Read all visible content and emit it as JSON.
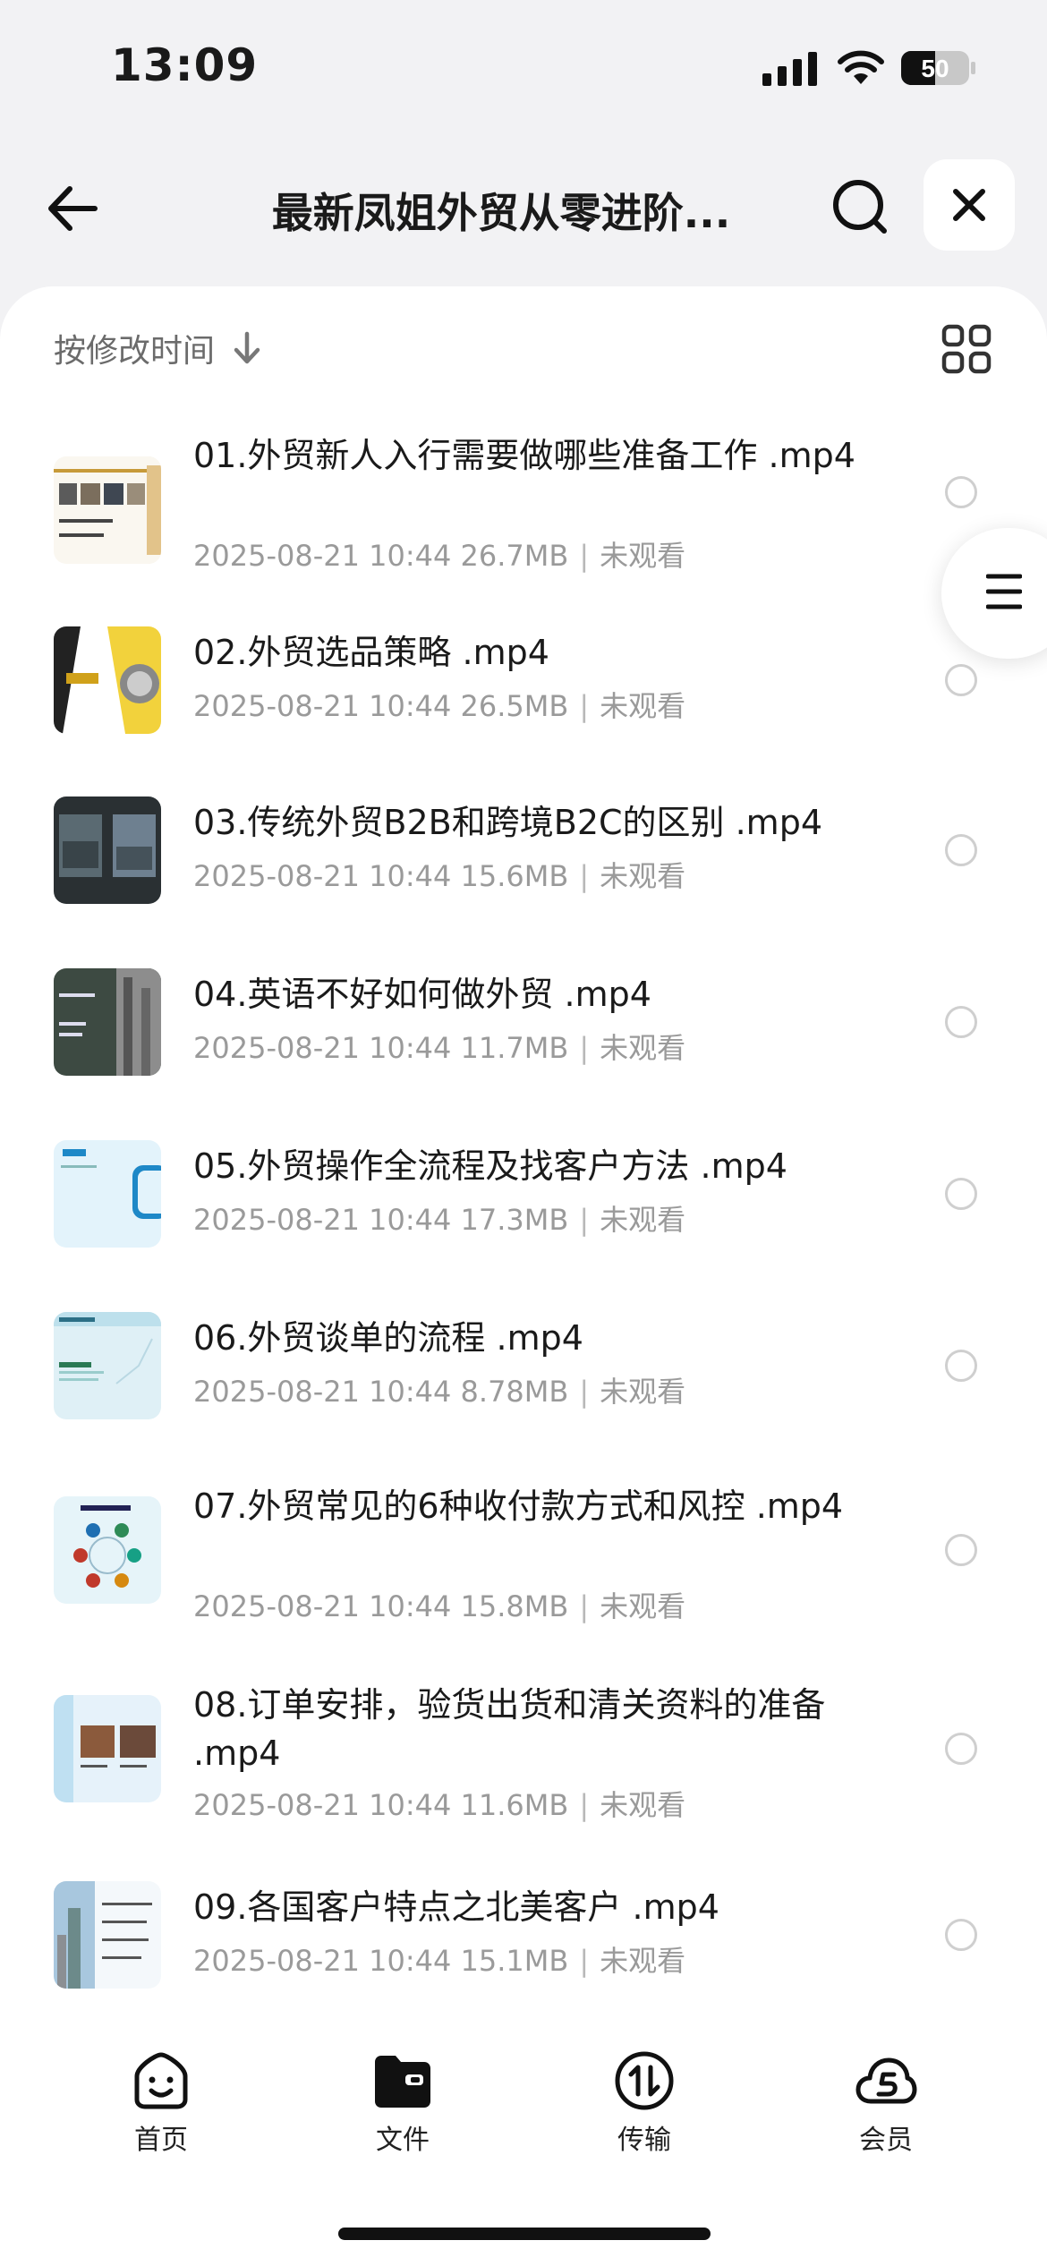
{
  "status_bar": {
    "time": "13:09",
    "battery_level": "50",
    "icons": [
      "signal-icon",
      "wifi-icon",
      "battery-icon"
    ]
  },
  "header": {
    "title": "最新凤姐外贸从零进阶...",
    "back_icon": "back-arrow-icon",
    "search_icon": "search-icon",
    "close_icon": "close-icon"
  },
  "toolbar": {
    "sort_label": "按修改时间",
    "sort_icon": "arrow-down-icon",
    "view_icon": "grid-icon"
  },
  "files": [
    {
      "name": "01.外贸新人入行需要做哪些准备工作 .mp4",
      "date": "2025-08-21 10:44",
      "size": "26.7MB",
      "status": "未观看"
    },
    {
      "name": "02.外贸选品策略 .mp4",
      "date": "2025-08-21 10:44",
      "size": "26.5MB",
      "status": "未观看"
    },
    {
      "name": "03.传统外贸B2B和跨境B2C的区别 .mp4",
      "date": "2025-08-21 10:44",
      "size": "15.6MB",
      "status": "未观看"
    },
    {
      "name": "04.英语不好如何做外贸 .mp4",
      "date": "2025-08-21 10:44",
      "size": "11.7MB",
      "status": "未观看"
    },
    {
      "name": "05.外贸操作全流程及找客户方法 .mp4",
      "date": "2025-08-21 10:44",
      "size": "17.3MB",
      "status": "未观看"
    },
    {
      "name": "06.外贸谈单的流程 .mp4",
      "date": "2025-08-21 10:44",
      "size": "8.78MB",
      "status": "未观看"
    },
    {
      "name": "07.外贸常见的6种收付款方式和风控 .mp4",
      "date": "2025-08-21 10:44",
      "size": "15.8MB",
      "status": "未观看"
    },
    {
      "name": "08.订单安排，验货出货和清关资料的准备 .mp4",
      "date": "2025-08-21 10:44",
      "size": "11.6MB",
      "status": "未观看"
    },
    {
      "name": "09.各国客户特点之北美客户 .mp4",
      "date": "2025-08-21 10:44",
      "size": "15.1MB",
      "status": "未观看"
    }
  ],
  "tabbar": {
    "tabs": [
      {
        "label": "首页",
        "icon": "home-smile-icon"
      },
      {
        "label": "文件",
        "icon": "folder-icon"
      },
      {
        "label": "传输",
        "icon": "transfer-icon"
      },
      {
        "label": "会员",
        "icon": "vip-cloud-icon"
      }
    ],
    "active_index": 1
  },
  "colors": {
    "background": "#f2f2f4",
    "sheet": "#ffffff",
    "meta_text": "#9a9a9a",
    "title_text": "#1a1a1a"
  }
}
